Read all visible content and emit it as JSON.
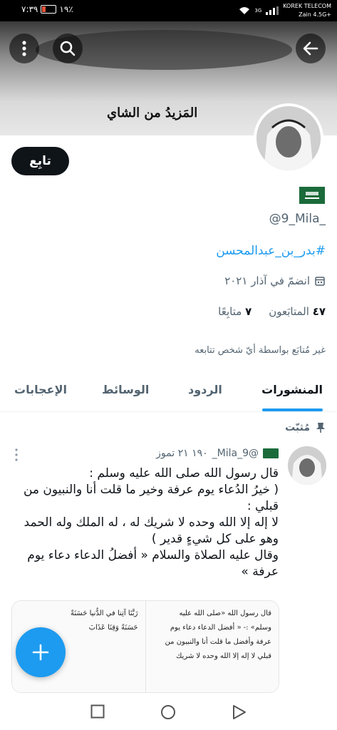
{
  "status_bar": {
    "time": "٧:٣٩",
    "battery": "١٩٪",
    "network": "3G",
    "carrier_top": "KOREK TELECOM",
    "carrier_bottom": "Zain 4.5G+"
  },
  "banner": {
    "caption": "المَزيدُ من الشاي"
  },
  "header": {
    "follow_label": "تابِع"
  },
  "profile": {
    "handle": "@9_Mila_",
    "hashtag": "#بدر_بن_عبدالمحسن",
    "joined": "انضمّ في آذار ٢٠٢١",
    "followers_count": "٤٧",
    "followers_label": "المتابَعون",
    "following_count": "٧",
    "following_label": "متابِعًا",
    "not_followed": "غير مُتابَع بواسطة أيّ شخص تتابعه"
  },
  "tabs": [
    {
      "label": "المنشورات"
    },
    {
      "label": "الردود"
    },
    {
      "label": "الوسائط"
    },
    {
      "label": "الإعجابات"
    }
  ],
  "pinned_label": "مُثبّت",
  "tweet": {
    "handle": "@9_Mila_",
    "meta": "١٩٠ ٢١ تموز",
    "body": [
      "قال رسول الله صلى الله عليه وسلم :",
      "( خيرُ الدُعاء يوم عرفة وخير ما قلت أنا والنبيون من قبلي :",
      "لا إله إلا الله وحده لا شريك له ، له الملك وله الحمد وهو على كل شيءٍ قدير )",
      "وقال عليه الصلاة والسلام « أفضلُ الدعاء دعاء يوم عرفة »"
    ],
    "images": [
      [
        "رَبَّنَا آتِنا في الدُّنيا حَسَنَةً",
        "حَسَنَةً وَقِنَا عَذَابَ"
      ],
      [
        "قال رسول الله «صلى الله عليه",
        "وسلم» :- « أفضل الدعاء دعاء يوم",
        "عرفة وأفضل ما قلت أنا والنبيون من",
        "قبلي لا إله إلا الله وحده لا شريك"
      ]
    ]
  },
  "icons": {
    "more": "more-vertical-icon",
    "search": "search-icon",
    "back": "arrow-back-icon",
    "calendar": "calendar-icon",
    "pin": "pin-icon",
    "compose": "plus-icon",
    "nav_recent": "square-icon",
    "nav_home": "circle-icon",
    "nav_back": "triangle-back-icon"
  },
  "colors": {
    "accent": "#1d9bf0",
    "text": "#0f1419",
    "muted": "#536471",
    "flag_green": "#1b6b3a"
  }
}
